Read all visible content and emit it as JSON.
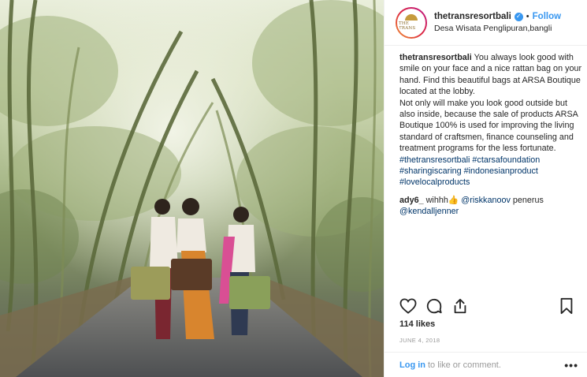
{
  "post": {
    "username": "thetransresortbali",
    "follow_label": "Follow",
    "location": "Desa Wisata Penglipuran,bangli",
    "avatar_text": "THE TRANS",
    "caption_username": "thetransresortbali",
    "caption_lines": [
      "You always look good with smile on your face and a nice rattan bag on your hand. Find this beautiful bags at ARSA Boutique located at the lobby.",
      "Not only will make you look good outside but also inside, because the sale of products ARSA Boutique 100% is used for improving the living standard of craftsmen, finance counseling and treatment programs for the less fortunate."
    ],
    "hashtags": "#thetransresortbali #ctarsafoundation #sharingiscaring #indonesianproduct #lovelocalproducts",
    "comment": {
      "username": "ady6_",
      "text_before": "wihhh",
      "emoji": "👍",
      "mention1": "@riskkanoov",
      "text_after": "penerus",
      "mention2": "@kendalljenner"
    },
    "likes": "114 likes",
    "date": "JUNE 4, 2018",
    "login_label": "Log in",
    "login_suffix": "to like or comment.",
    "more_label": "•••"
  },
  "icons": {
    "like": "heart-icon",
    "comment": "comment-icon",
    "share": "share-icon",
    "save": "bookmark-icon",
    "verified": "verified-badge-icon"
  },
  "colors": {
    "accent": "#3897f0",
    "hashtag": "#003569",
    "muted": "#999999",
    "text": "#262626"
  }
}
